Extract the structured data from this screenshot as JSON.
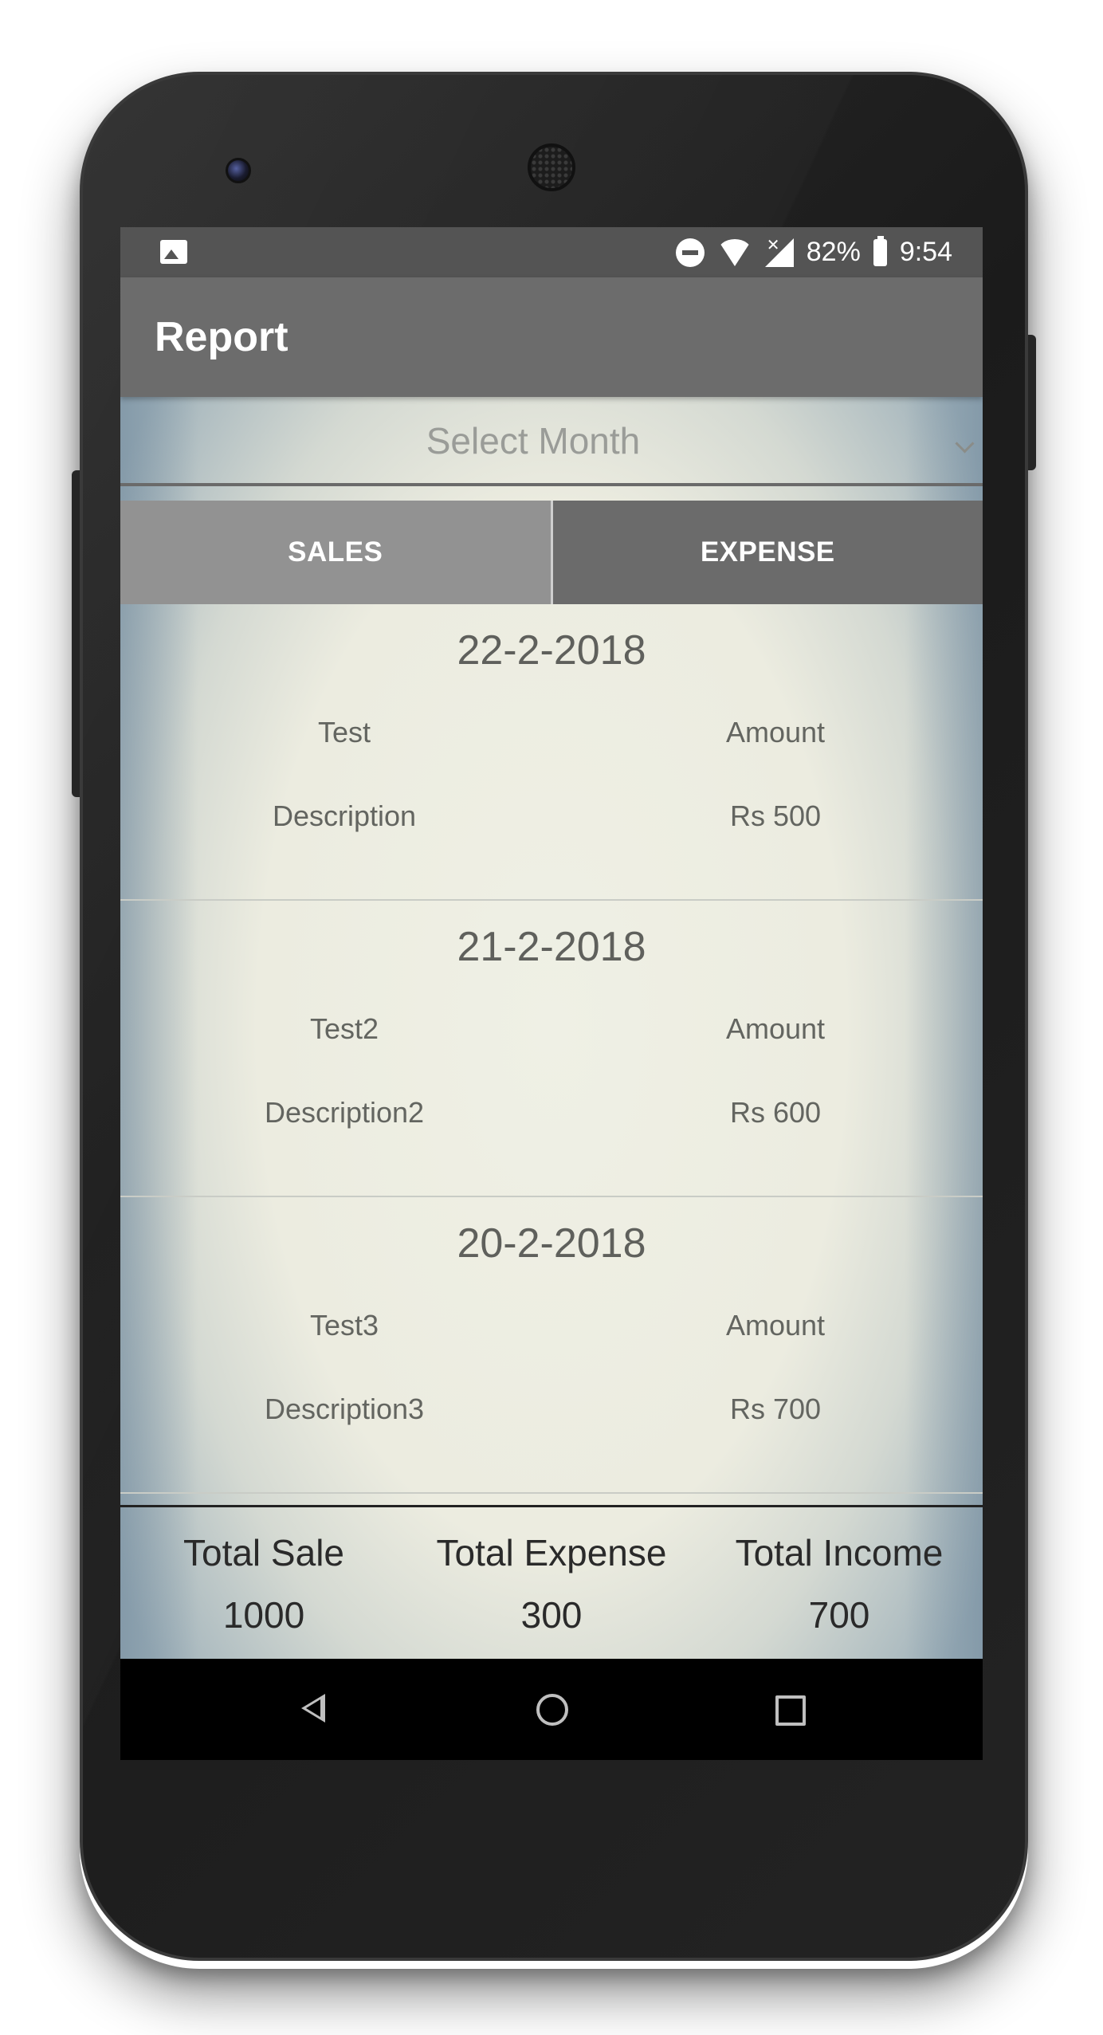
{
  "status_bar": {
    "battery": "82%",
    "time": "9:54",
    "icons": [
      "image-icon",
      "do-not-disturb-icon",
      "wifi-icon",
      "signal-icon",
      "battery-icon"
    ]
  },
  "app_bar": {
    "title": "Report"
  },
  "month_select": {
    "placeholder": "Select Month"
  },
  "tabs": [
    {
      "label": "SALES",
      "active": false
    },
    {
      "label": "EXPENSE",
      "active": true
    }
  ],
  "records": [
    {
      "date": "22-2-2018",
      "title": "Test",
      "description": "Description",
      "amount_label": "Amount",
      "amount": "Rs 500"
    },
    {
      "date": "21-2-2018",
      "title": "Test2",
      "description": "Description2",
      "amount_label": "Amount",
      "amount": "Rs 600"
    },
    {
      "date": "20-2-2018",
      "title": "Test3",
      "description": "Description3",
      "amount_label": "Amount",
      "amount": "Rs 700"
    }
  ],
  "totals": [
    {
      "label": "Total Sale",
      "value": "1000"
    },
    {
      "label": "Total Expense",
      "value": "300"
    },
    {
      "label": "Total Income",
      "value": "700"
    }
  ],
  "nav_bar": {
    "icons": [
      "back-icon",
      "home-icon",
      "recents-icon"
    ]
  },
  "colors": {
    "app_bar": "#6c6c6c",
    "status_bar": "#545454",
    "tab_sales": "#929292",
    "tab_expense": "#6b6b6b"
  }
}
